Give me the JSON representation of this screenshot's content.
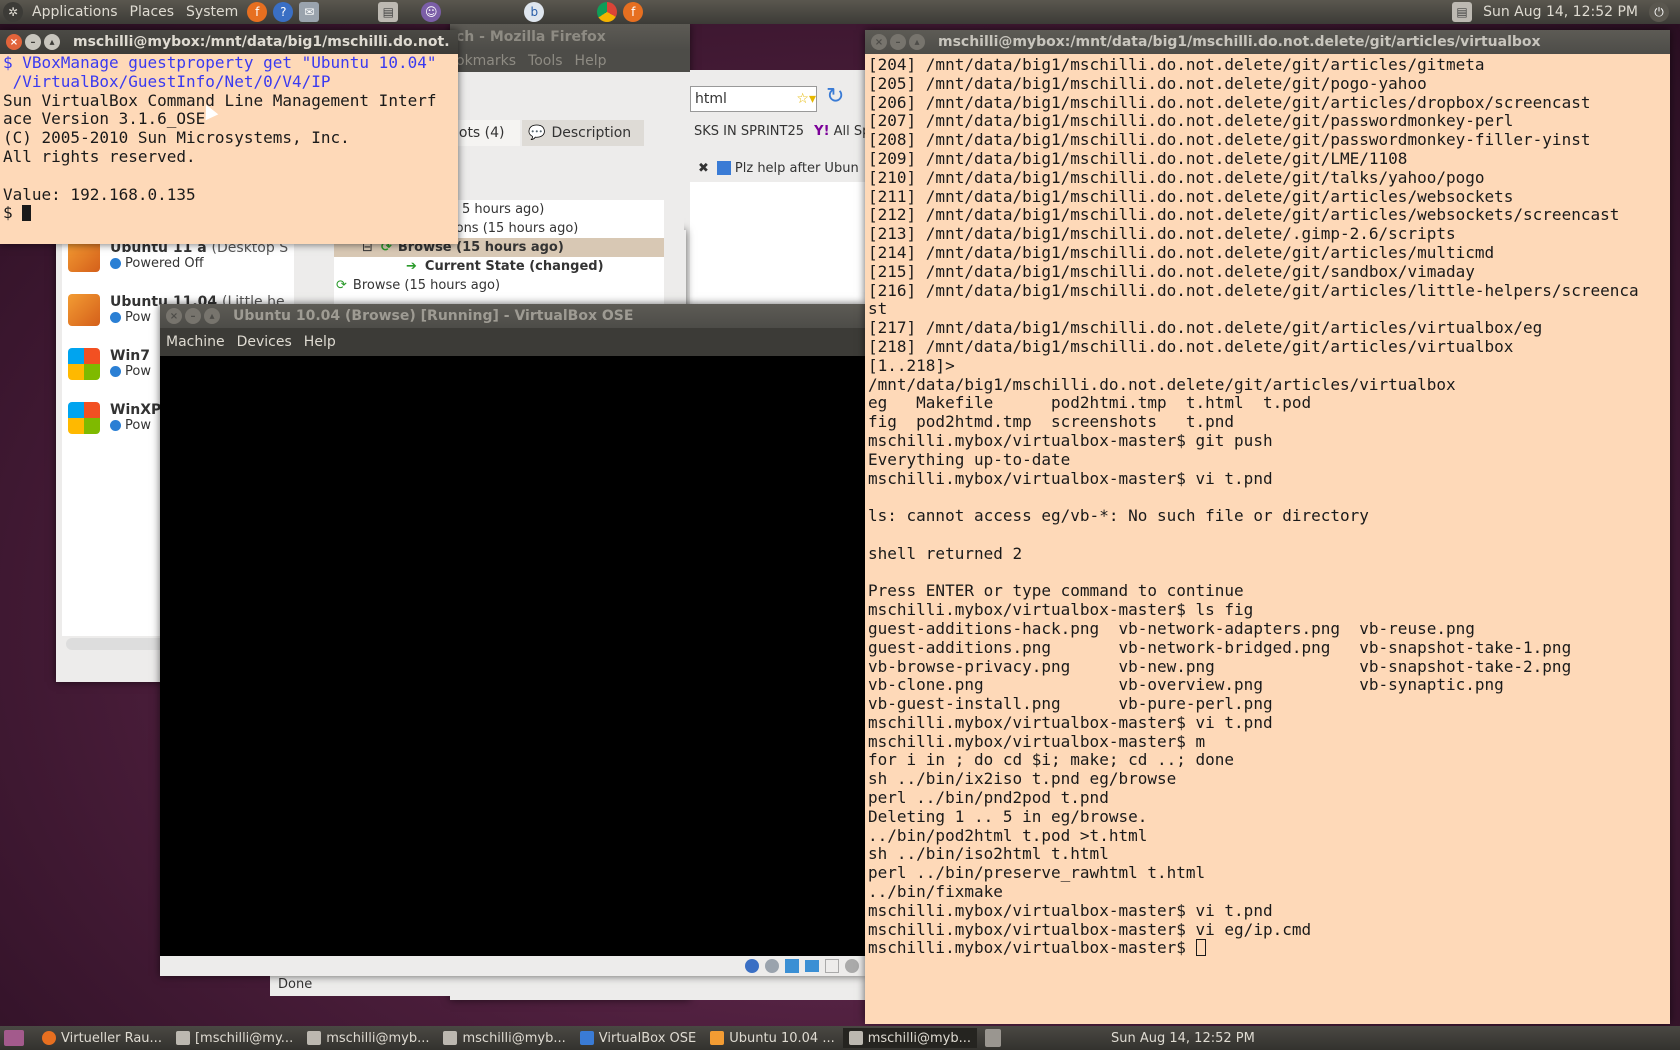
{
  "top_panel": {
    "menus": [
      "Applications",
      "Places",
      "System"
    ],
    "clock": "Sun Aug 14, 12:52 PM"
  },
  "firefox": {
    "title": "ch - Mozilla Firefox",
    "menus": [
      "okmarks",
      "Tools",
      "Help"
    ],
    "url": "html",
    "bookmark1": "SKS IN SPRINT25",
    "bookmark2": "All Spr",
    "tab": "Plz help after Ubun",
    "status": "Done"
  },
  "vbox_manager": {
    "tab_snapshots": "hots (4)",
    "tab_description": "Description",
    "snapshots": [
      "5 hours ago)",
      "ions (15 hours ago)",
      "Browse (15 hours ago)",
      "Current State (changed)",
      "Browse (15 hours ago)"
    ],
    "vms": [
      {
        "name": "Ubuntu 11 a",
        "sub": "(Desktop S",
        "state": "Powered Off"
      },
      {
        "name": "Ubuntu 11.04",
        "sub": "(Little he",
        "state": "Pow"
      },
      {
        "name": "Win7",
        "sub": "",
        "state": "Pow"
      },
      {
        "name": "WinXP",
        "sub": "",
        "state": "Pow"
      }
    ]
  },
  "vbox_vm": {
    "title": "Ubuntu 10.04 (Browse) [Running] - VirtualBox OSE",
    "menus": [
      "Machine",
      "Devices",
      "Help"
    ]
  },
  "term_small": {
    "title": "mschilli@mybox:/mnt/data/big1/mschilli.do.not.",
    "cmd_line1": "$ VBoxManage guestproperty get \"Ubuntu 10.04\"",
    "cmd_line2": " /VirtualBox/GuestInfo/Net/0/V4/IP",
    "output": [
      "Sun VirtualBox Command Line Management Interf",
      "ace Version 3.1.6_OSE",
      "(C) 2005-2010 Sun Microsystems, Inc.",
      "All rights reserved.",
      "",
      "Value: 192.168.0.135"
    ],
    "prompt": "$ "
  },
  "term_large": {
    "title": "mschilli@mybox:/mnt/data/big1/mschilli.do.not.delete/git/articles/virtualbox",
    "lines": [
      "[204] /mnt/data/big1/mschilli.do.not.delete/git/articles/gitmeta",
      "[205] /mnt/data/big1/mschilli.do.not.delete/git/pogo-yahoo",
      "[206] /mnt/data/big1/mschilli.do.not.delete/git/articles/dropbox/screencast",
      "[207] /mnt/data/big1/mschilli.do.not.delete/git/passwordmonkey-perl",
      "[208] /mnt/data/big1/mschilli.do.not.delete/git/passwordmonkey-filler-yinst",
      "[209] /mnt/data/big1/mschilli.do.not.delete/git/LME/1108",
      "[210] /mnt/data/big1/mschilli.do.not.delete/git/talks/yahoo/pogo",
      "[211] /mnt/data/big1/mschilli.do.not.delete/git/articles/websockets",
      "[212] /mnt/data/big1/mschilli.do.not.delete/git/articles/websockets/screencast",
      "[213] /mnt/data/big1/mschilli.do.not.delete/.gimp-2.6/scripts",
      "[214] /mnt/data/big1/mschilli.do.not.delete/git/articles/multicmd",
      "[215] /mnt/data/big1/mschilli.do.not.delete/git/sandbox/vimaday",
      "[216] /mnt/data/big1/mschilli.do.not.delete/git/articles/little-helpers/screenca",
      "st",
      "[217] /mnt/data/big1/mschilli.do.not.delete/git/articles/virtualbox/eg",
      "[218] /mnt/data/big1/mschilli.do.not.delete/git/articles/virtualbox",
      "[1..218]>",
      "/mnt/data/big1/mschilli.do.not.delete/git/articles/virtualbox",
      "eg   Makefile      pod2htmi.tmp  t.html  t.pod",
      "fig  pod2htmd.tmp  screenshots   t.pnd",
      "mschilli.mybox/virtualbox-master$ git push",
      "Everything up-to-date",
      "mschilli.mybox/virtualbox-master$ vi t.pnd",
      "",
      "ls: cannot access eg/vb-*: No such file or directory",
      "",
      "shell returned 2",
      "",
      "Press ENTER or type command to continue",
      "mschilli.mybox/virtualbox-master$ ls fig",
      "guest-additions-hack.png  vb-network-adapters.png  vb-reuse.png",
      "guest-additions.png       vb-network-bridged.png   vb-snapshot-take-1.png",
      "vb-browse-privacy.png     vb-new.png               vb-snapshot-take-2.png",
      "vb-clone.png              vb-overview.png          vb-synaptic.png",
      "vb-guest-install.png      vb-pure-perl.png",
      "mschilli.mybox/virtualbox-master$ vi t.pnd",
      "mschilli.mybox/virtualbox-master$ m",
      "for i in ; do cd $i; make; cd ..; done",
      "sh ../bin/ix2iso t.pnd eg/browse",
      "perl ../bin/pnd2pod t.pnd",
      "Deleting 1 .. 5 in eg/browse.",
      "../bin/pod2html t.pod >t.html",
      "sh ../bin/iso2html t.html",
      "perl ../bin/preserve_rawhtml t.html",
      "../bin/fixmake",
      "mschilli.mybox/virtualbox-master$ vi t.pnd",
      "mschilli.mybox/virtualbox-master$ vi eg/ip.cmd"
    ],
    "prompt": "mschilli.mybox/virtualbox-master$ "
  },
  "taskbar": {
    "tasks": [
      "Virtueller Rau...",
      "[mschilli@my...",
      "mschilli@myb...",
      "mschilli@myb...",
      "VirtualBox OSE",
      "Ubuntu 10.04 ...",
      "mschilli@myb..."
    ],
    "clock": "Sun Aug 14, 12:52 PM"
  },
  "colors": {
    "terminal_bg": "#fed9b8",
    "command_blue": "#3a3af0",
    "panel_dark": "#3c3b37",
    "close_orange": "#e1633a"
  }
}
